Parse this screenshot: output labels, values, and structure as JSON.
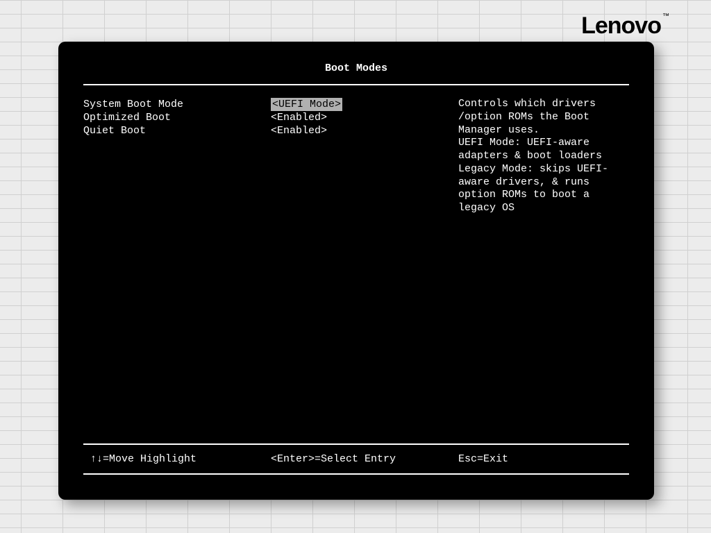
{
  "brand": "Lenovo",
  "screen_title": "Boot Modes",
  "settings": [
    {
      "label": "System Boot Mode",
      "value": "<UEFI Mode>",
      "selected": true
    },
    {
      "label": "Optimized Boot",
      "value": "<Enabled>",
      "selected": false
    },
    {
      "label": "Quiet Boot",
      "value": "<Enabled>",
      "selected": false
    }
  ],
  "help_text": "Controls which drivers /option ROMs the Boot Manager uses.\nUEFI Mode: UEFI-aware adapters & boot loaders\nLegacy Mode: skips UEFI-aware drivers, & runs option ROMs to boot a legacy OS",
  "footer": {
    "move": "↑↓=Move Highlight",
    "select": "<Enter>=Select Entry",
    "exit": "Esc=Exit"
  }
}
